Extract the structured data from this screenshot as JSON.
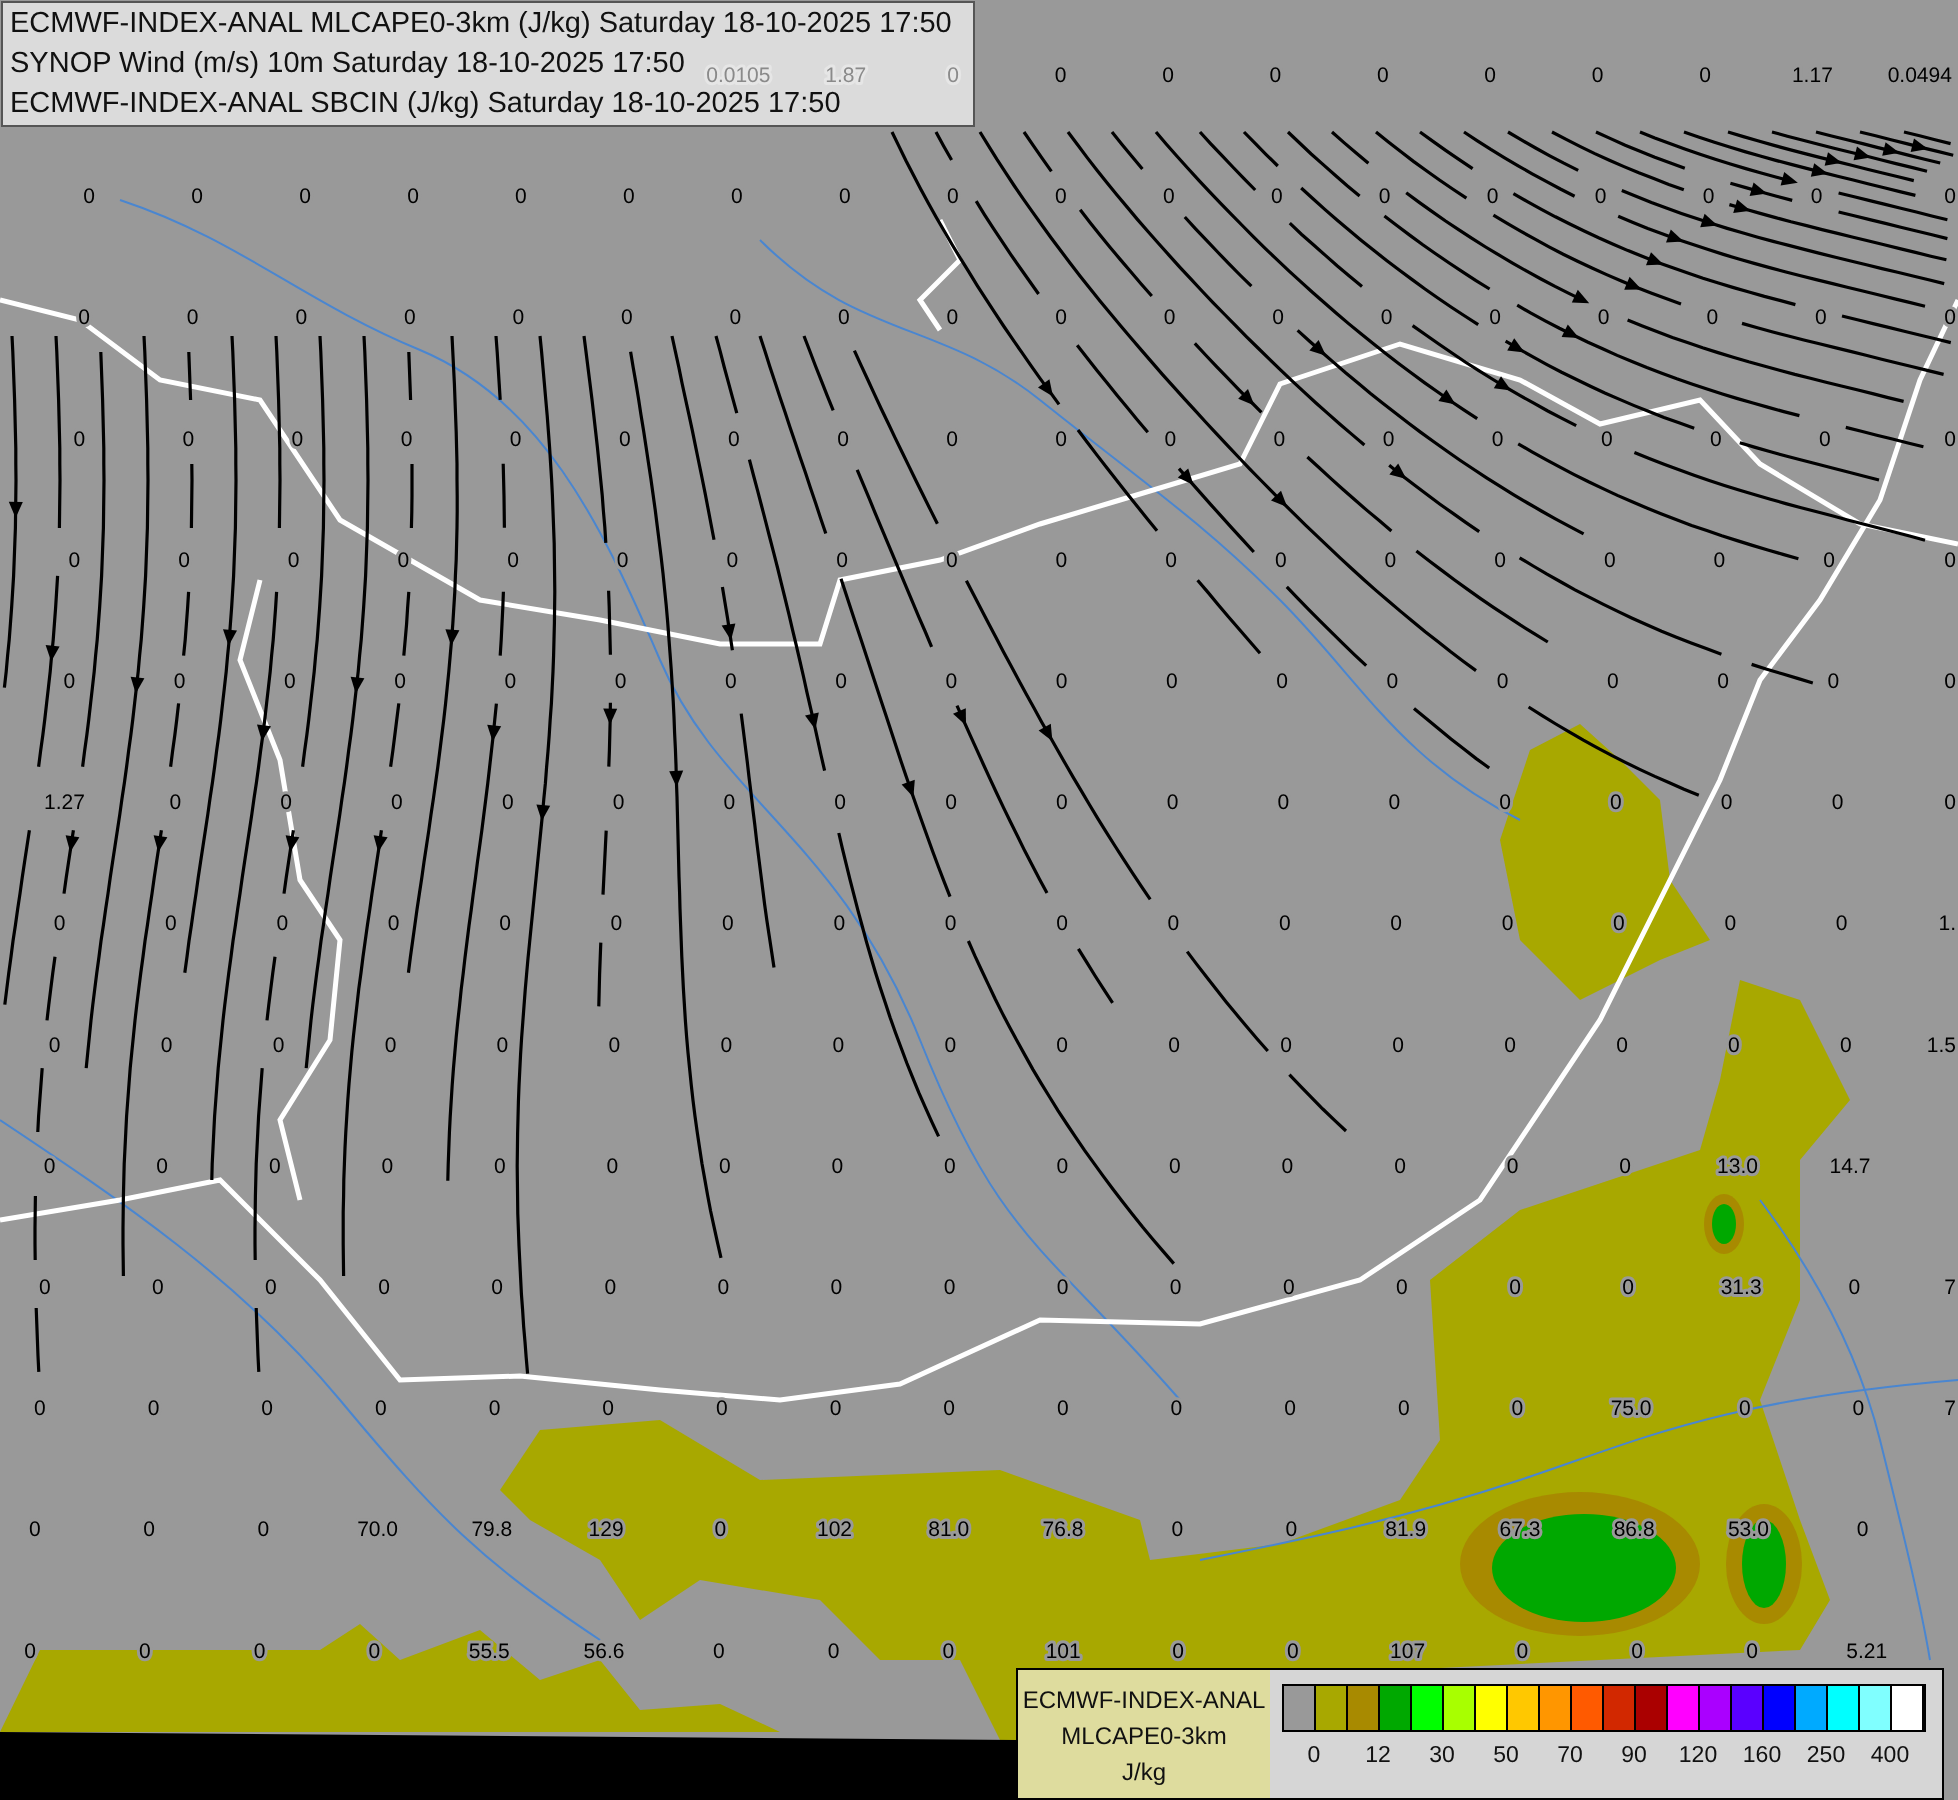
{
  "header": {
    "lines": [
      "ECMWF-INDEX-ANAL MLCAPE0-3km (J/kg) Saturday 18-10-2025 17:50",
      "SYNOP Wind (m/s) 10m Saturday 18-10-2025 17:50",
      "ECMWF-INDEX-ANAL SBCIN (J/kg) Saturday 18-10-2025 17:50"
    ]
  },
  "station_values": [
    [
      "0.0105",
      "1.87",
      "0",
      "0",
      "0",
      "0",
      "0",
      "0",
      "0",
      "0",
      "1.17",
      "0.0494"
    ],
    [
      "0",
      "0",
      "0",
      "0",
      "0",
      "0",
      "0",
      "0",
      "0",
      "0",
      "0",
      "0",
      "0",
      "0",
      "0",
      "0",
      "0",
      "0"
    ],
    [
      "0",
      "0",
      "0",
      "0",
      "0",
      "0",
      "0",
      "0",
      "0",
      "0",
      "0",
      "0",
      "0",
      "0",
      "0",
      "0",
      "0",
      "0"
    ],
    [
      "0",
      "0",
      "0",
      "0",
      "0",
      "0",
      "0",
      "0",
      "0",
      "0",
      "0",
      "0",
      "0",
      "0",
      "0",
      "0",
      "0",
      "0"
    ],
    [
      "0",
      "0",
      "0",
      "0",
      "0",
      "0",
      "0",
      "0",
      "0",
      "0",
      "0",
      "0",
      "0",
      "0",
      "0",
      "0",
      "0",
      "0"
    ],
    [
      "0",
      "0",
      "0",
      "0",
      "0",
      "0",
      "0",
      "0",
      "0",
      "0",
      "0",
      "0",
      "0",
      "0",
      "0",
      "0",
      "0",
      "0"
    ],
    [
      "1.27",
      "0",
      "0",
      "0",
      "0",
      "0",
      "0",
      "0",
      "0",
      "0",
      "0",
      "0",
      "0",
      "0",
      "0",
      "0",
      "0",
      "0"
    ],
    [
      "0",
      "0",
      "0",
      "0",
      "0",
      "0",
      "0",
      "0",
      "0",
      "0",
      "0",
      "0",
      "0",
      "0",
      "0",
      "0",
      "0",
      "1."
    ],
    [
      "0",
      "0",
      "0",
      "0",
      "0",
      "0",
      "0",
      "0",
      "0",
      "0",
      "0",
      "0",
      "0",
      "0",
      "0",
      "0",
      "0",
      "1.5"
    ],
    [
      "0",
      "0",
      "0",
      "0",
      "0",
      "0",
      "0",
      "0",
      "0",
      "0",
      "0",
      "0",
      "0",
      "0",
      "0",
      "13.0",
      "14.7"
    ],
    [
      "0",
      "0",
      "0",
      "0",
      "0",
      "0",
      "0",
      "0",
      "0",
      "0",
      "0",
      "0",
      "0",
      "0",
      "0",
      "31.3",
      "0",
      "7"
    ],
    [
      "0",
      "0",
      "0",
      "0",
      "0",
      "0",
      "0",
      "0",
      "0",
      "0",
      "0",
      "0",
      "0",
      "0",
      "75.0",
      "0",
      "0",
      "7"
    ],
    [
      "0",
      "0",
      "0",
      "70.0",
      "79.8",
      "129",
      "0",
      "102",
      "81.0",
      "76.8",
      "0",
      "0",
      "81.9",
      "67.3",
      "86.8",
      "53.0",
      "0"
    ],
    [
      "0",
      "0",
      "0",
      "0",
      "55.5",
      "56.6",
      "0",
      "0",
      "0",
      "101",
      "0",
      "0",
      "107",
      "0",
      "0",
      "0",
      "5.21"
    ]
  ],
  "legend": {
    "lines": [
      "ECMWF-INDEX-ANAL",
      "MLCAPE0-3km",
      "J/kg"
    ],
    "swatches": [
      {
        "color": "#999999"
      },
      {
        "color": "#a8a800"
      },
      {
        "color": "#a88a00"
      },
      {
        "color": "#00a800"
      },
      {
        "color": "#00ff00"
      },
      {
        "color": "#a8ff00"
      },
      {
        "color": "#ffff00"
      },
      {
        "color": "#ffc800"
      },
      {
        "color": "#ff9600"
      },
      {
        "color": "#ff5a00"
      },
      {
        "color": "#d22800"
      },
      {
        "color": "#aa0000"
      },
      {
        "color": "#ff00ff"
      },
      {
        "color": "#aa00ff"
      },
      {
        "color": "#5a00ff"
      },
      {
        "color": "#0000ff"
      },
      {
        "color": "#00aaff"
      },
      {
        "color": "#00ffff"
      },
      {
        "color": "#80ffff"
      },
      {
        "color": "#ffffff"
      }
    ],
    "ticks": [
      "0",
      "12",
      "30",
      "50",
      "70",
      "90",
      "120",
      "160",
      "250",
      "400"
    ]
  }
}
